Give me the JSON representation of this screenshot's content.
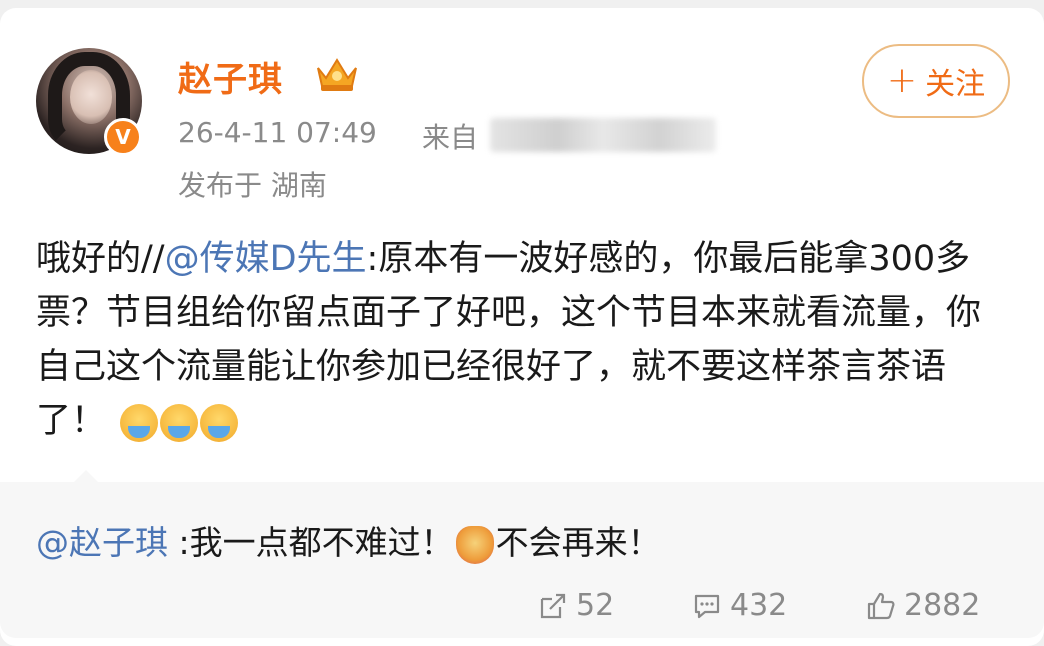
{
  "user": {
    "name": "赵子琪",
    "verified_mark": "V",
    "post_time": "26-4-11 07:49",
    "source_prefix": "来自",
    "location": "发布于 湖南"
  },
  "follow_button": {
    "plus": "+",
    "label": "关注"
  },
  "post": {
    "prefix": "哦好的//",
    "mention": "@传媒D先生",
    "body": ":原本有一波好感的，你最后能拿300多票？节目组给你留点面子了好吧，这个节目本来就看流量，你自己这个流量能让你参加已经很好了，就不要这样茶言茶语了！",
    "emoji_icons": [
      "crying-face-icon",
      "crying-face-icon",
      "crying-face-icon"
    ]
  },
  "repost": {
    "mention": "@赵子琪",
    "text_before": " :我一点都不难过！",
    "text_after": "不会再来！",
    "emoji_icon": "cat-heart-icon"
  },
  "actions": {
    "share_count": "52",
    "comment_count": "432",
    "like_count": "2882"
  },
  "colors": {
    "accent": "#f06b16",
    "mention": "#4c76b5",
    "meta": "#8a8a8a"
  }
}
